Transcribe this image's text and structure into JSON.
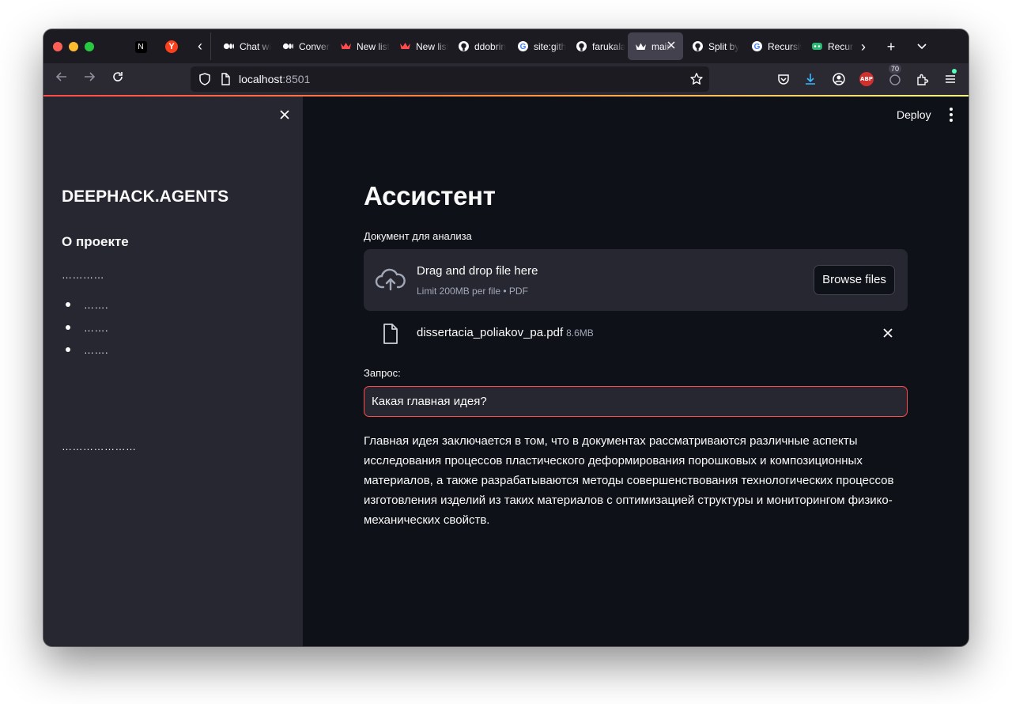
{
  "browser": {
    "tabs": [
      {
        "title": "Chat with",
        "favicon": "medium-icon",
        "active": false
      },
      {
        "title": "Conversational",
        "favicon": "medium-icon",
        "active": false
      },
      {
        "title": "New listing",
        "favicon": "crown-icon",
        "active": false
      },
      {
        "title": "New listing",
        "favicon": "crown-icon",
        "active": false
      },
      {
        "title": "ddobrin",
        "favicon": "github-icon",
        "active": false
      },
      {
        "title": "site:github",
        "favicon": "google-icon",
        "active": false
      },
      {
        "title": "farukalam",
        "favicon": "github-icon",
        "active": false
      },
      {
        "title": "main",
        "favicon": "streamlit-icon",
        "active": true
      },
      {
        "title": "Split by",
        "favicon": "github-icon",
        "active": false
      },
      {
        "title": "Recursive",
        "favicon": "google-icon",
        "active": false
      },
      {
        "title": "Recursive",
        "favicon": "app-icon",
        "active": false
      }
    ],
    "url_host": "localhost",
    "url_port": ":8501",
    "extension_badge": "70",
    "abp_label": "ABP"
  },
  "app": {
    "deploy_label": "Deploy",
    "sidebar": {
      "title": "DEEPHACK.AGENTS",
      "subtitle": "О проекте",
      "dots": "…………",
      "items": [
        "…….",
        "…….",
        "……."
      ],
      "footer_dots": "…………………"
    },
    "main": {
      "title": "Ассистент",
      "upload_label": "Документ для анализа",
      "dropzone_main": "Drag and drop file here",
      "dropzone_sub": "Limit 200MB per file • PDF",
      "browse_label": "Browse files",
      "file_name": "dissertacia_poliakov_pa.pdf",
      "file_size": "8.6MB",
      "query_label": "Запрос:",
      "query_value": "Какая главная идея?",
      "answer": "Главная идея заключается в том, что в документах рассматриваются различные аспекты исследования процессов пластического деформирования порошковых и композиционных материалов, а также разрабатываются методы совершенствования технологических процессов изготовления изделий из таких материалов с оптимизацией структуры и мониторингом физико-механических свойств."
    }
  },
  "colors": {
    "accent": "#ff4b4b",
    "sidebar_bg": "#262730",
    "main_bg": "#0e1117",
    "browser_chrome": "#2b2a33"
  }
}
